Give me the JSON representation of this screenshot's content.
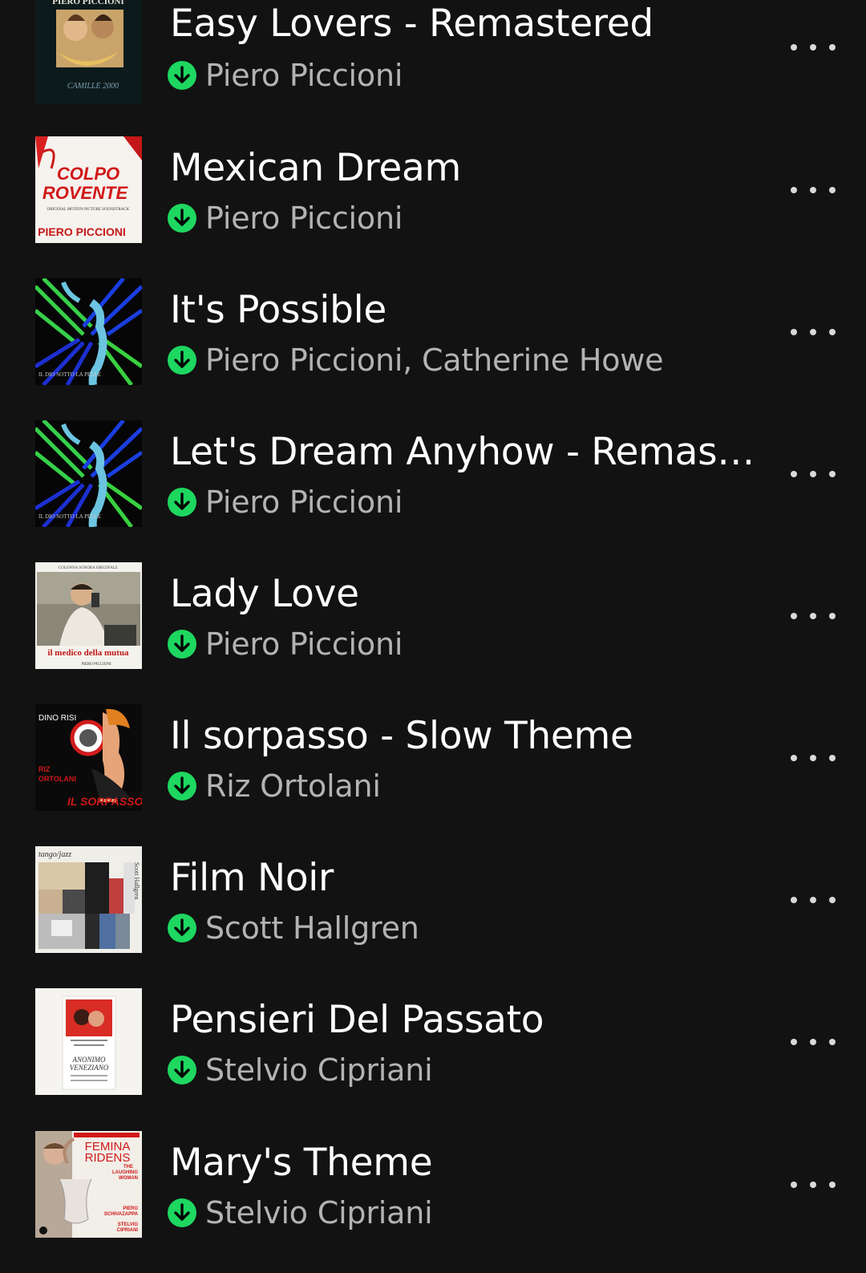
{
  "colors": {
    "background": "#121212",
    "title": "#ffffff",
    "artist": "#b3b3b3",
    "download_badge": "#1ed760"
  },
  "tracks": [
    {
      "title": "Easy Lovers - Remastered",
      "artist": "Piero Piccioni",
      "downloaded": true,
      "cover_text": [
        "PIERO PICCIONI",
        "CAMILLE 2000"
      ],
      "more_icon": "more-horizontal-icon"
    },
    {
      "title": "Mexican Dream",
      "artist": "Piero Piccioni",
      "downloaded": true,
      "cover_text": [
        "COLPO",
        "ROVENTE",
        "ORIGINAL MOTION PICTURE SOUNDTRACK",
        "PIERO PICCIONI"
      ],
      "more_icon": "more-horizontal-icon"
    },
    {
      "title": "It's Possible",
      "artist": "Piero Piccioni, Catherine Howe",
      "downloaded": true,
      "cover_text": [
        "IL DIO SOTTO LA PELLE"
      ],
      "more_icon": "more-horizontal-icon"
    },
    {
      "title": "Let's Dream Anyhow - Remaste...",
      "artist": "Piero Piccioni",
      "downloaded": true,
      "cover_text": [
        "IL DIO SOTTO LA PELLE"
      ],
      "more_icon": "more-horizontal-icon"
    },
    {
      "title": "Lady Love",
      "artist": "Piero Piccioni",
      "downloaded": true,
      "cover_text": [
        "COLONNA SONORA ORIGINALE",
        "il medico della mutua",
        "PIERO PICCIONI"
      ],
      "more_icon": "more-horizontal-icon"
    },
    {
      "title": "Il sorpasso - Slow Theme",
      "artist": "Riz Ortolani",
      "downloaded": true,
      "cover_text": [
        "DINO RISI",
        "RIZ",
        "ORTOLANI",
        "IL SORPASSO"
      ],
      "more_icon": "more-horizontal-icon"
    },
    {
      "title": "Film Noir",
      "artist": "Scott Hallgren",
      "downloaded": true,
      "cover_text": [
        "tango/jazz",
        "Scott Hallgren"
      ],
      "more_icon": "more-horizontal-icon"
    },
    {
      "title": "Pensieri Del Passato",
      "artist": "Stelvio Cipriani",
      "downloaded": true,
      "cover_text": [
        "ANONIMO",
        "VENEZIANO"
      ],
      "more_icon": "more-horizontal-icon"
    },
    {
      "title": "Mary's Theme",
      "artist": "Stelvio Cipriani",
      "downloaded": true,
      "cover_text": [
        "FEMINA",
        "RIDENS",
        "THE",
        "LAUGHING",
        "WOMAN",
        "PIERO",
        "SCHIVAZAPPA",
        "STELVIO",
        "CIPRIANI"
      ],
      "more_icon": "more-horizontal-icon"
    }
  ]
}
